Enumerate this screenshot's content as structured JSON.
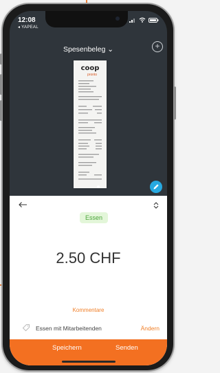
{
  "status_bar": {
    "time": "12:08",
    "back_app": "◂ YAPEAL"
  },
  "header": {
    "title": "Spesenbeleg ⌄"
  },
  "receipt": {
    "brand": "coop",
    "sub": "pronto"
  },
  "expense": {
    "category": "Essen",
    "amount": "2.50 CHF",
    "comments_label": "Kommentare",
    "comment_text": "Essen mit Mitarbeitenden",
    "change_label": "Ändern"
  },
  "actions": {
    "save_label": "Speichern",
    "send_label": "Senden"
  },
  "colors": {
    "accent": "#f37021",
    "tag_bg": "#e3f6d9",
    "tag_text": "#4aa53a",
    "edit_button": "#27a9e1"
  }
}
